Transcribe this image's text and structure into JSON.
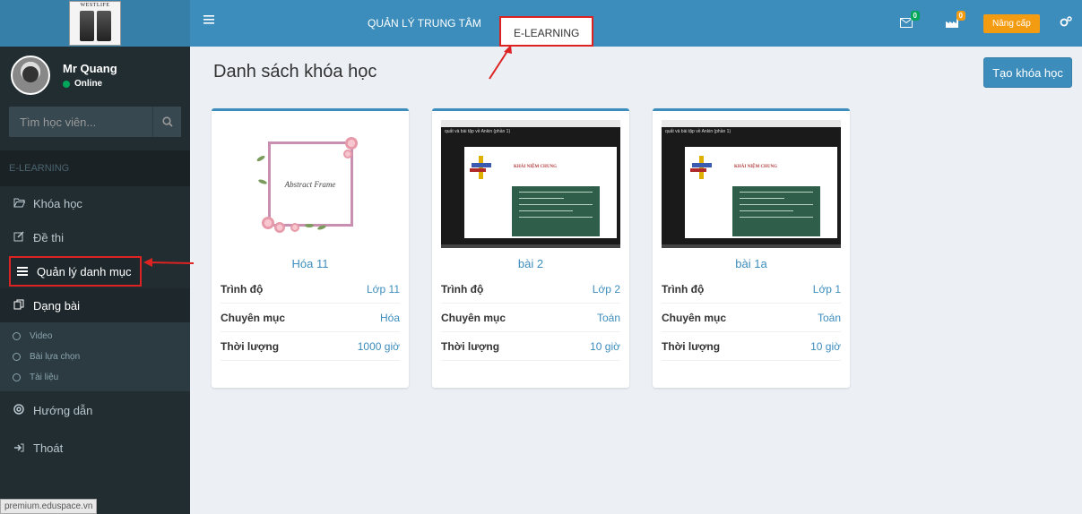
{
  "logo": {
    "text": "WESTLIFE"
  },
  "user": {
    "name": "Mr Quang",
    "status": "Online"
  },
  "search": {
    "placeholder": "Tìm học viên..."
  },
  "sidebar": {
    "section_header": "E-LEARNING",
    "items": [
      {
        "label": "Khóa học",
        "icon": "folder-open-icon"
      },
      {
        "label": "Đề thi",
        "icon": "edit-icon"
      },
      {
        "label": "Quản lý danh mục",
        "icon": "list-icon"
      },
      {
        "label": "Dạng bài",
        "icon": "copy-icon"
      }
    ],
    "sub_items": [
      {
        "label": "Video"
      },
      {
        "label": "Bài lựa chọn"
      },
      {
        "label": "Tài liệu"
      }
    ],
    "bottom_items": [
      {
        "label": "Hướng dẫn",
        "icon": "life-ring-icon"
      },
      {
        "label": "Thoát",
        "icon": "sign-out-icon"
      }
    ],
    "footer_url": "premium.eduspace.vn"
  },
  "topbar": {
    "nav_center": "QUẢN LÝ TRUNG TÂM",
    "nav_elearning": "E-LEARNING",
    "mail_badge": "0",
    "factory_badge": "0",
    "upgrade_label": "Nâng cấp"
  },
  "main": {
    "title": "Danh sách khóa học",
    "create_button": "Tạo khóa học"
  },
  "courses": [
    {
      "title": "Hóa 11",
      "thumb_text": "Abstract Frame",
      "rows": [
        {
          "label": "Trình độ",
          "value": "Lớp 11"
        },
        {
          "label": "Chuyên mục",
          "value": "Hóa"
        },
        {
          "label": "Thời lượng",
          "value": "1000 giờ"
        }
      ]
    },
    {
      "title": "bài 2",
      "thumb_text": "KHÁI NIỆM CHUNG",
      "thumb_caption": "quất và bài tập về Ankin (phần 1)",
      "rows": [
        {
          "label": "Trình độ",
          "value": "Lớp 2"
        },
        {
          "label": "Chuyên mục",
          "value": "Toán"
        },
        {
          "label": "Thời lượng",
          "value": "10 giờ"
        }
      ]
    },
    {
      "title": "bài 1a",
      "thumb_text": "KHÁI NIỆM CHUNG",
      "thumb_caption": "quất và bài tập về Ankin (phần 1)",
      "rows": [
        {
          "label": "Trình độ",
          "value": "Lớp 1"
        },
        {
          "label": "Chuyên mục",
          "value": "Toán"
        },
        {
          "label": "Thời lượng",
          "value": "10 giờ"
        }
      ]
    }
  ],
  "colors": {
    "header_blue": "#3c8dbc",
    "sidebar_dark": "#222d32",
    "upgrade_orange": "#f39c12",
    "annotation_red": "#dd2222"
  }
}
